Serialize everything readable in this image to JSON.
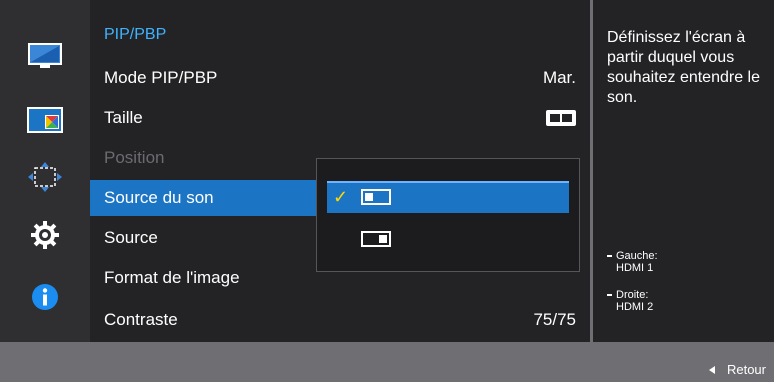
{
  "sidebar": {
    "icons": [
      "monitor-icon",
      "pip-icon",
      "resize-arrows-icon",
      "gear-icon",
      "info-icon"
    ],
    "selected_index": 1
  },
  "menu": {
    "title": "PIP/PBP",
    "items": [
      {
        "label": "Mode PIP/PBP",
        "value": "Mar."
      },
      {
        "label": "Taille",
        "value_icon": "size-pbp-icon"
      },
      {
        "label": "Position",
        "disabled": true
      },
      {
        "label": "Source du son",
        "highlighted": true
      },
      {
        "label": "Source"
      },
      {
        "label": "Format de l'image"
      },
      {
        "label": "Contraste",
        "value": "75/75"
      }
    ]
  },
  "popup": {
    "options": [
      {
        "icon": "left-window-icon",
        "selected": true,
        "check": "✓"
      },
      {
        "icon": "right-window-icon",
        "selected": false
      }
    ]
  },
  "info_panel": {
    "description": "Définissez l'écran à partir duquel vous souhaitez entendre le son.",
    "notes": [
      {
        "line1": "Gauche:",
        "line2": "HDMI 1"
      },
      {
        "line1": "Droite:",
        "line2": "HDMI 2"
      }
    ]
  },
  "footer": {
    "back_label": "Retour"
  },
  "colors": {
    "accent": "#1b74c4",
    "title": "#3fb3ff",
    "check": "#ffd700",
    "panel_bg": "#232326",
    "frame_bg": "#6f6f73"
  }
}
